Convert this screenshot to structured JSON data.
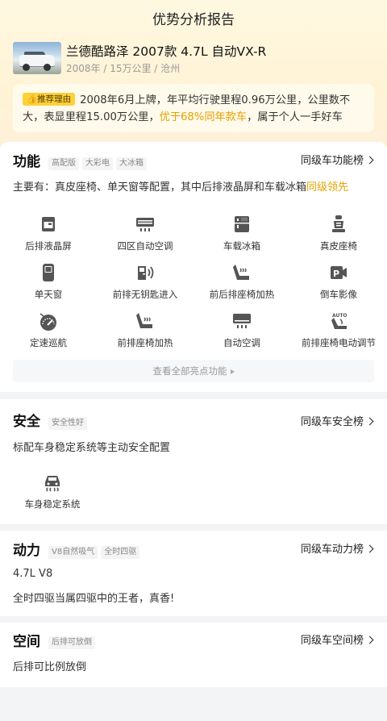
{
  "header": {
    "title": "优势分析报告"
  },
  "car": {
    "name": "兰德酷路泽 2007款 4.7L 自动VX-R",
    "meta": "2008年 / 15万公里 / 沧州"
  },
  "reason": {
    "tag": "推荐理由",
    "text1": "2008年6月上牌，年平均行驶里程0.96万公里，公里数不大，表显里程15.00万公里，",
    "highlight": "优于68%同年款车",
    "text2": "，属于个人一手好车"
  },
  "features": {
    "title": "功能",
    "chips": [
      "高配版",
      "大彩电",
      "大冰箱"
    ],
    "rank": "同级车功能榜",
    "desc": "主要有：真皮座椅、单天窗等配置，其中后排液晶屏和车载冰箱",
    "desc_highlight": "同级领先",
    "items": [
      {
        "label": "后排液晶屏",
        "icon": "rear-screen-icon"
      },
      {
        "label": "四区自动空调",
        "icon": "ac-icon"
      },
      {
        "label": "车载冰箱",
        "icon": "fridge-icon"
      },
      {
        "label": "真皮座椅",
        "icon": "leather-seat-icon"
      },
      {
        "label": "单天窗",
        "icon": "sunroof-icon"
      },
      {
        "label": "前排无钥匙进入",
        "icon": "keyless-entry-icon"
      },
      {
        "label": "前后排座椅加热",
        "icon": "seat-heat-icon"
      },
      {
        "label": "倒车影像",
        "icon": "reverse-camera-icon"
      },
      {
        "label": "定速巡航",
        "icon": "cruise-icon"
      },
      {
        "label": "前排座椅加热",
        "icon": "seat-heat-icon"
      },
      {
        "label": "自动空调",
        "icon": "auto-ac-icon"
      },
      {
        "label": "前排座椅电动调节",
        "icon": "power-seat-icon"
      }
    ],
    "more": "查看全部亮点功能"
  },
  "safety": {
    "title": "安全",
    "chips": [
      "安全性好"
    ],
    "rank": "同级车安全榜",
    "desc": "标配车身稳定系统等主动安全配置",
    "items": [
      {
        "label": "车身稳定系统",
        "icon": "esp-icon"
      }
    ]
  },
  "power": {
    "title": "动力",
    "chips": [
      "V8自然吸气",
      "全时四驱"
    ],
    "rank": "同级车动力榜",
    "line1": "4.7L V8",
    "line2": "全时四驱当属四驱中的王者，真香!"
  },
  "space": {
    "title": "空间",
    "chips": [
      "后排可放倒"
    ],
    "rank": "同级车空间榜",
    "desc": "后排可比例放倒"
  }
}
